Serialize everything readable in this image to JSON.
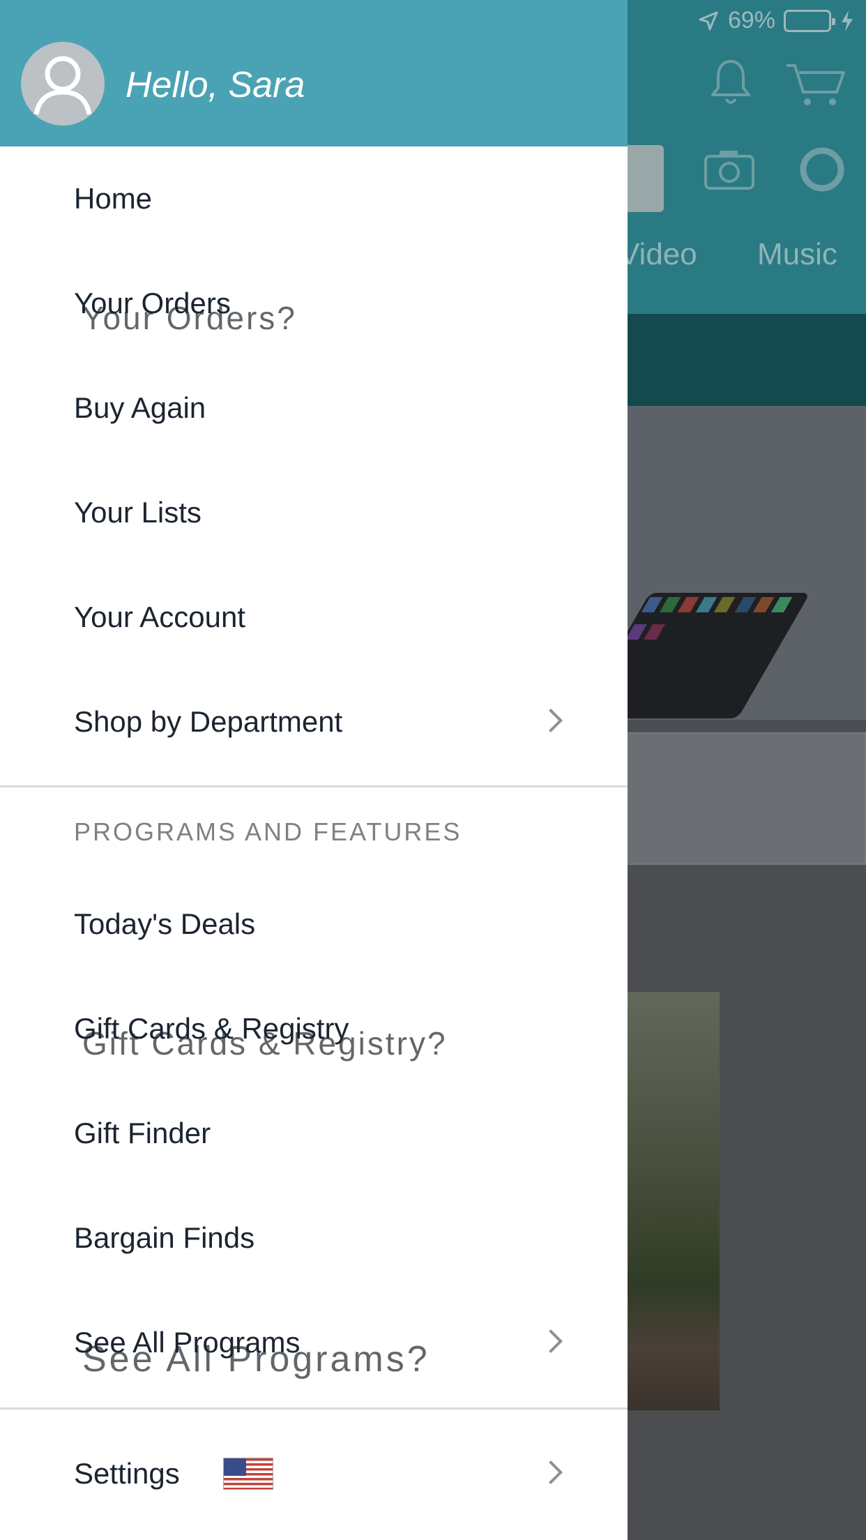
{
  "status_bar": {
    "battery_percent": "69%",
    "battery_level": 0.69
  },
  "background_tabs": [
    "Video",
    "Music"
  ],
  "drawer": {
    "greeting": "Hello, Sara",
    "primary_items": [
      {
        "label": "Home",
        "chevron": false
      },
      {
        "label": "Your Orders",
        "chevron": false,
        "ghost": "Your Orders?"
      },
      {
        "label": "Buy Again",
        "chevron": false
      },
      {
        "label": "Your Lists",
        "chevron": false
      },
      {
        "label": "Your Account",
        "chevron": false
      },
      {
        "label": "Shop by Department",
        "chevron": true
      }
    ],
    "programs_section": {
      "heading": "PROGRAMS AND FEATURES",
      "items": [
        {
          "label": "Today's Deals",
          "chevron": false
        },
        {
          "label": "Gift Cards & Registry",
          "chevron": false,
          "ghost": "Gift Cards & Registry?"
        },
        {
          "label": "Gift Finder",
          "chevron": false
        },
        {
          "label": "Bargain Finds",
          "chevron": false
        },
        {
          "label": "See All Programs",
          "chevron": true,
          "ghost": "See All Programs?"
        }
      ]
    },
    "settings": {
      "label": "Settings",
      "flag_icon": "us-flag-icon",
      "chevron": true
    }
  },
  "colors": {
    "drawer_header": "#4aa3b4",
    "text": "#1b2430",
    "section_heading": "#7d8187"
  }
}
